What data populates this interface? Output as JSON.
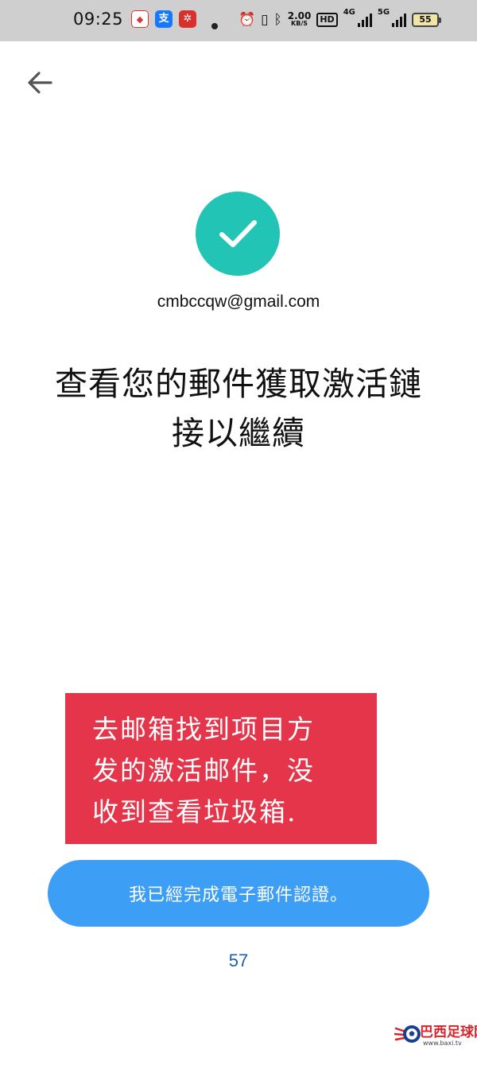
{
  "status_bar": {
    "time": "09:25",
    "apps": [
      "baidu-app-icon",
      "alipay-app-icon",
      "news-app-icon"
    ],
    "net_speed_value": "2.00",
    "net_speed_unit": "KB/S",
    "hd_label": "HD",
    "signal_1_label": "4G",
    "signal_2_label": "5G",
    "battery": "55"
  },
  "header": {
    "back_icon": "arrow-left-icon"
  },
  "main": {
    "status_icon": "checkmark-icon",
    "status_color": "#21c4b5",
    "email": "cmbccqw@gmail.com",
    "headline_line1": "查看您的郵件獲取激活鏈",
    "headline_line2": "接以繼續"
  },
  "note": {
    "line1": "去邮箱找到项目方",
    "line2": "发的激活邮件，没",
    "line3": "收到查看垃圾箱.",
    "color": "#e4354a"
  },
  "confirm_button": {
    "label": "我已經完成電子郵件認證。",
    "color": "#3d9ef6"
  },
  "countdown": "57",
  "watermark": {
    "text": "巴西足球网",
    "url": "www.baxi.tv"
  }
}
